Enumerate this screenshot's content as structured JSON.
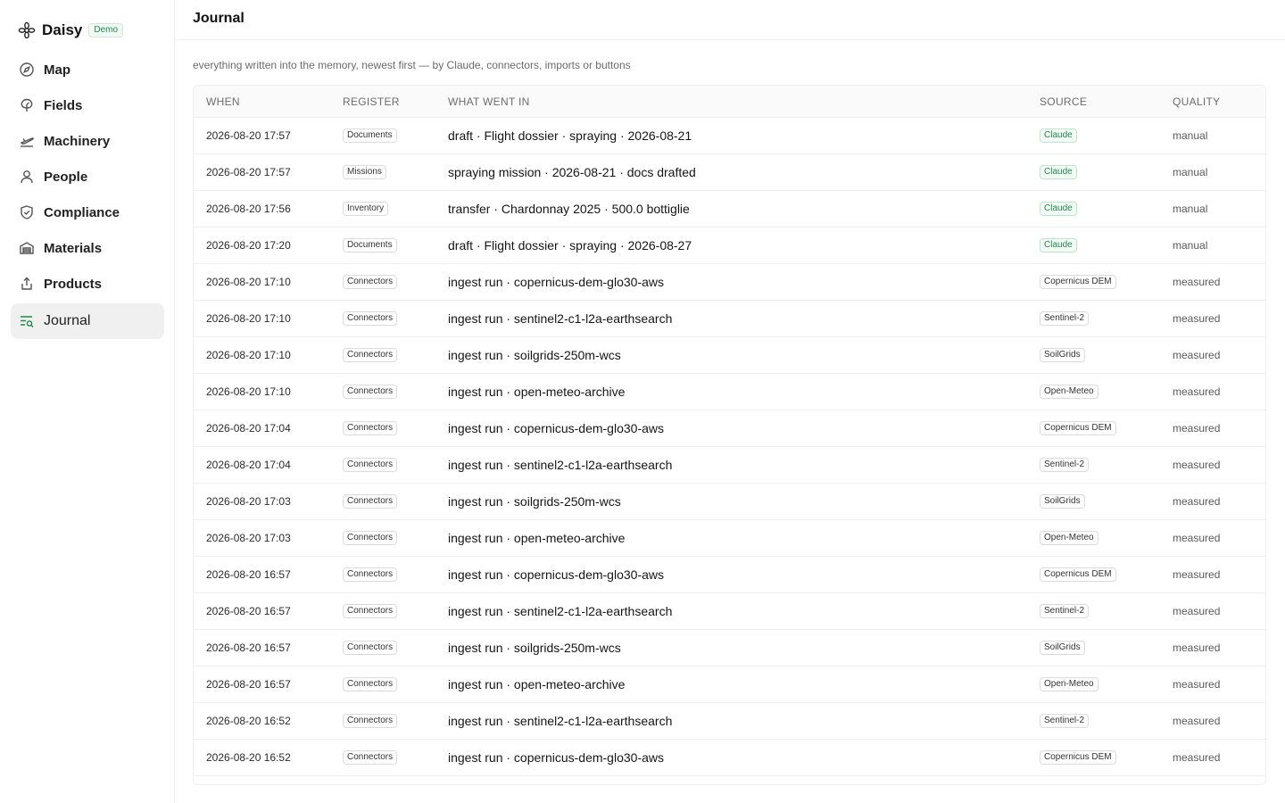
{
  "app": {
    "name": "Daisy",
    "badge": "Demo"
  },
  "sidebar": {
    "items": [
      {
        "label": "Map",
        "icon": "compass-icon"
      },
      {
        "label": "Fields",
        "icon": "leaf-icon"
      },
      {
        "label": "Machinery",
        "icon": "plane-icon"
      },
      {
        "label": "People",
        "icon": "person-icon"
      },
      {
        "label": "Compliance",
        "icon": "shield-check-icon"
      },
      {
        "label": "Materials",
        "icon": "warehouse-icon"
      },
      {
        "label": "Products",
        "icon": "share-icon"
      },
      {
        "label": "Journal",
        "icon": "journal-search-icon",
        "active": true
      }
    ]
  },
  "header": {
    "title": "Journal"
  },
  "subtitle": "everything written into the memory, newest first — by Claude, connectors, imports or buttons",
  "table": {
    "columns": {
      "when": "WHEN",
      "register": "REGISTER",
      "what": "WHAT WENT IN",
      "source": "SOURCE",
      "quality": "QUALITY"
    },
    "rows": [
      {
        "when": "2026-08-20 17:57",
        "register": "Documents",
        "what": "draft · Flight dossier · spraying · 2026-08-21",
        "source": "Claude",
        "quality": "manual"
      },
      {
        "when": "2026-08-20 17:57",
        "register": "Missions",
        "what": "spraying mission · 2026-08-21 · docs drafted",
        "source": "Claude",
        "quality": "manual"
      },
      {
        "when": "2026-08-20 17:56",
        "register": "Inventory",
        "what": "transfer · Chardonnay 2025 · 500.0 bottiglie",
        "source": "Claude",
        "quality": "manual"
      },
      {
        "when": "2026-08-20 17:20",
        "register": "Documents",
        "what": "draft · Flight dossier · spraying · 2026-08-27",
        "source": "Claude",
        "quality": "manual"
      },
      {
        "when": "2026-08-20 17:10",
        "register": "Connectors",
        "what": "ingest run · copernicus-dem-glo30-aws",
        "source": "Copernicus DEM",
        "quality": "measured"
      },
      {
        "when": "2026-08-20 17:10",
        "register": "Connectors",
        "what": "ingest run · sentinel2-c1-l2a-earthsearch",
        "source": "Sentinel-2",
        "quality": "measured"
      },
      {
        "when": "2026-08-20 17:10",
        "register": "Connectors",
        "what": "ingest run · soilgrids-250m-wcs",
        "source": "SoilGrids",
        "quality": "measured"
      },
      {
        "when": "2026-08-20 17:10",
        "register": "Connectors",
        "what": "ingest run · open-meteo-archive",
        "source": "Open-Meteo",
        "quality": "measured"
      },
      {
        "when": "2026-08-20 17:04",
        "register": "Connectors",
        "what": "ingest run · copernicus-dem-glo30-aws",
        "source": "Copernicus DEM",
        "quality": "measured"
      },
      {
        "when": "2026-08-20 17:04",
        "register": "Connectors",
        "what": "ingest run · sentinel2-c1-l2a-earthsearch",
        "source": "Sentinel-2",
        "quality": "measured"
      },
      {
        "when": "2026-08-20 17:03",
        "register": "Connectors",
        "what": "ingest run · soilgrids-250m-wcs",
        "source": "SoilGrids",
        "quality": "measured"
      },
      {
        "when": "2026-08-20 17:03",
        "register": "Connectors",
        "what": "ingest run · open-meteo-archive",
        "source": "Open-Meteo",
        "quality": "measured"
      },
      {
        "when": "2026-08-20 16:57",
        "register": "Connectors",
        "what": "ingest run · copernicus-dem-glo30-aws",
        "source": "Copernicus DEM",
        "quality": "measured"
      },
      {
        "when": "2026-08-20 16:57",
        "register": "Connectors",
        "what": "ingest run · sentinel2-c1-l2a-earthsearch",
        "source": "Sentinel-2",
        "quality": "measured"
      },
      {
        "when": "2026-08-20 16:57",
        "register": "Connectors",
        "what": "ingest run · soilgrids-250m-wcs",
        "source": "SoilGrids",
        "quality": "measured"
      },
      {
        "when": "2026-08-20 16:57",
        "register": "Connectors",
        "what": "ingest run · open-meteo-archive",
        "source": "Open-Meteo",
        "quality": "measured"
      },
      {
        "when": "2026-08-20 16:52",
        "register": "Connectors",
        "what": "ingest run · sentinel2-c1-l2a-earthsearch",
        "source": "Sentinel-2",
        "quality": "measured"
      },
      {
        "when": "2026-08-20 16:52",
        "register": "Connectors",
        "what": "ingest run · copernicus-dem-glo30-aws",
        "source": "Copernicus DEM",
        "quality": "measured"
      }
    ]
  },
  "colors": {
    "accent": "#1f8a4c",
    "active_bg": "#f0f0f0",
    "border": "#efefef"
  }
}
